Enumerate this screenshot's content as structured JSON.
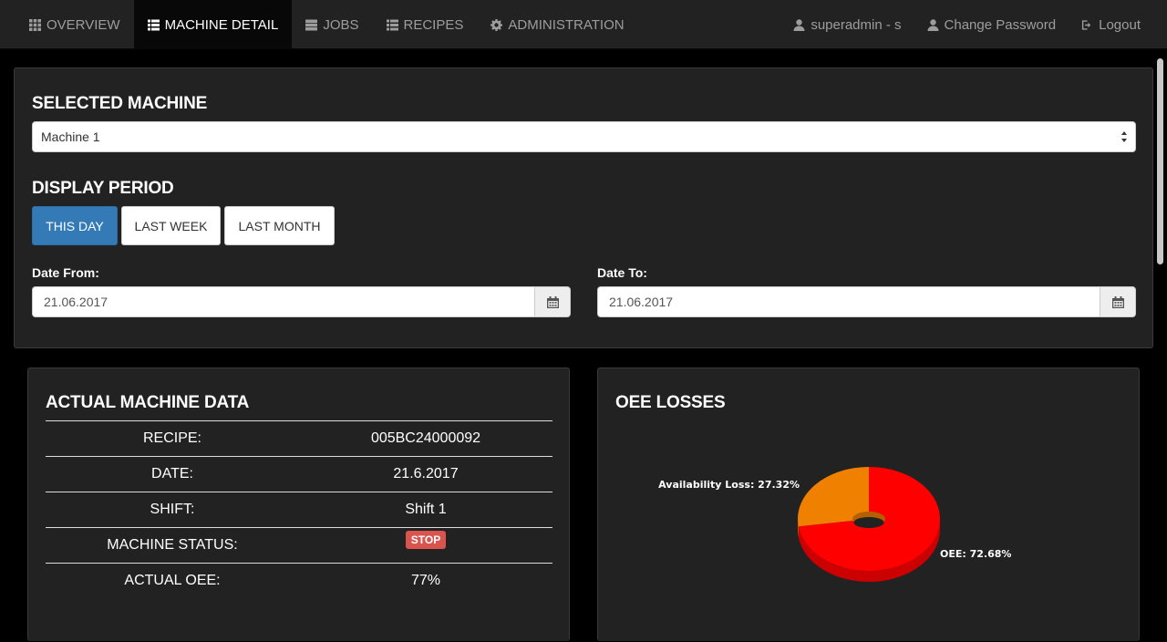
{
  "navbar": {
    "left": [
      {
        "label": "OVERVIEW",
        "icon": "grid-icon",
        "active": false
      },
      {
        "label": "MACHINE DETAIL",
        "icon": "list-icon",
        "active": true
      },
      {
        "label": "JOBS",
        "icon": "server-icon",
        "active": false
      },
      {
        "label": "RECIPES",
        "icon": "list-icon",
        "active": false
      },
      {
        "label": "ADMINISTRATION",
        "icon": "gear-icon",
        "active": false
      }
    ],
    "user_label": "superadmin - s",
    "change_password_label": "Change Password",
    "logout_label": "Logout"
  },
  "filter": {
    "selected_machine_title": "SELECTED MACHINE",
    "machine_value": "Machine 1",
    "display_period_title": "DISPLAY PERIOD",
    "period_buttons": [
      {
        "label": "THIS DAY",
        "active": true
      },
      {
        "label": "LAST WEEK",
        "active": false
      },
      {
        "label": "LAST MONTH",
        "active": false
      }
    ],
    "date_from_label": "Date From:",
    "date_from_value": "21.06.2017",
    "date_to_label": "Date To:",
    "date_to_value": "21.06.2017"
  },
  "machine_data": {
    "title": "ACTUAL MACHINE DATA",
    "rows": [
      {
        "label": "RECIPE:",
        "value": "005BC24000092"
      },
      {
        "label": "DATE:",
        "value": "21.6.2017"
      },
      {
        "label": "SHIFT:",
        "value": "Shift 1"
      },
      {
        "label": "MACHINE STATUS:",
        "value": "STOP"
      },
      {
        "label": "ACTUAL OEE:",
        "value": "77%"
      }
    ],
    "status_color": "#d9534f"
  },
  "oee_losses": {
    "title": "OEE LOSSES"
  },
  "chart_data": {
    "type": "pie",
    "title": "OEE LOSSES",
    "donut": true,
    "slices": [
      {
        "label": "OEE: 72.68%",
        "value": 72.68,
        "color": "#ff0000"
      },
      {
        "label": "Availability Loss: 27.32%",
        "value": 27.32,
        "color": "#f08000"
      }
    ]
  },
  "colors": {
    "accent": "#337ab7",
    "navbar_bg": "#222222",
    "page_bg": "#000000"
  }
}
